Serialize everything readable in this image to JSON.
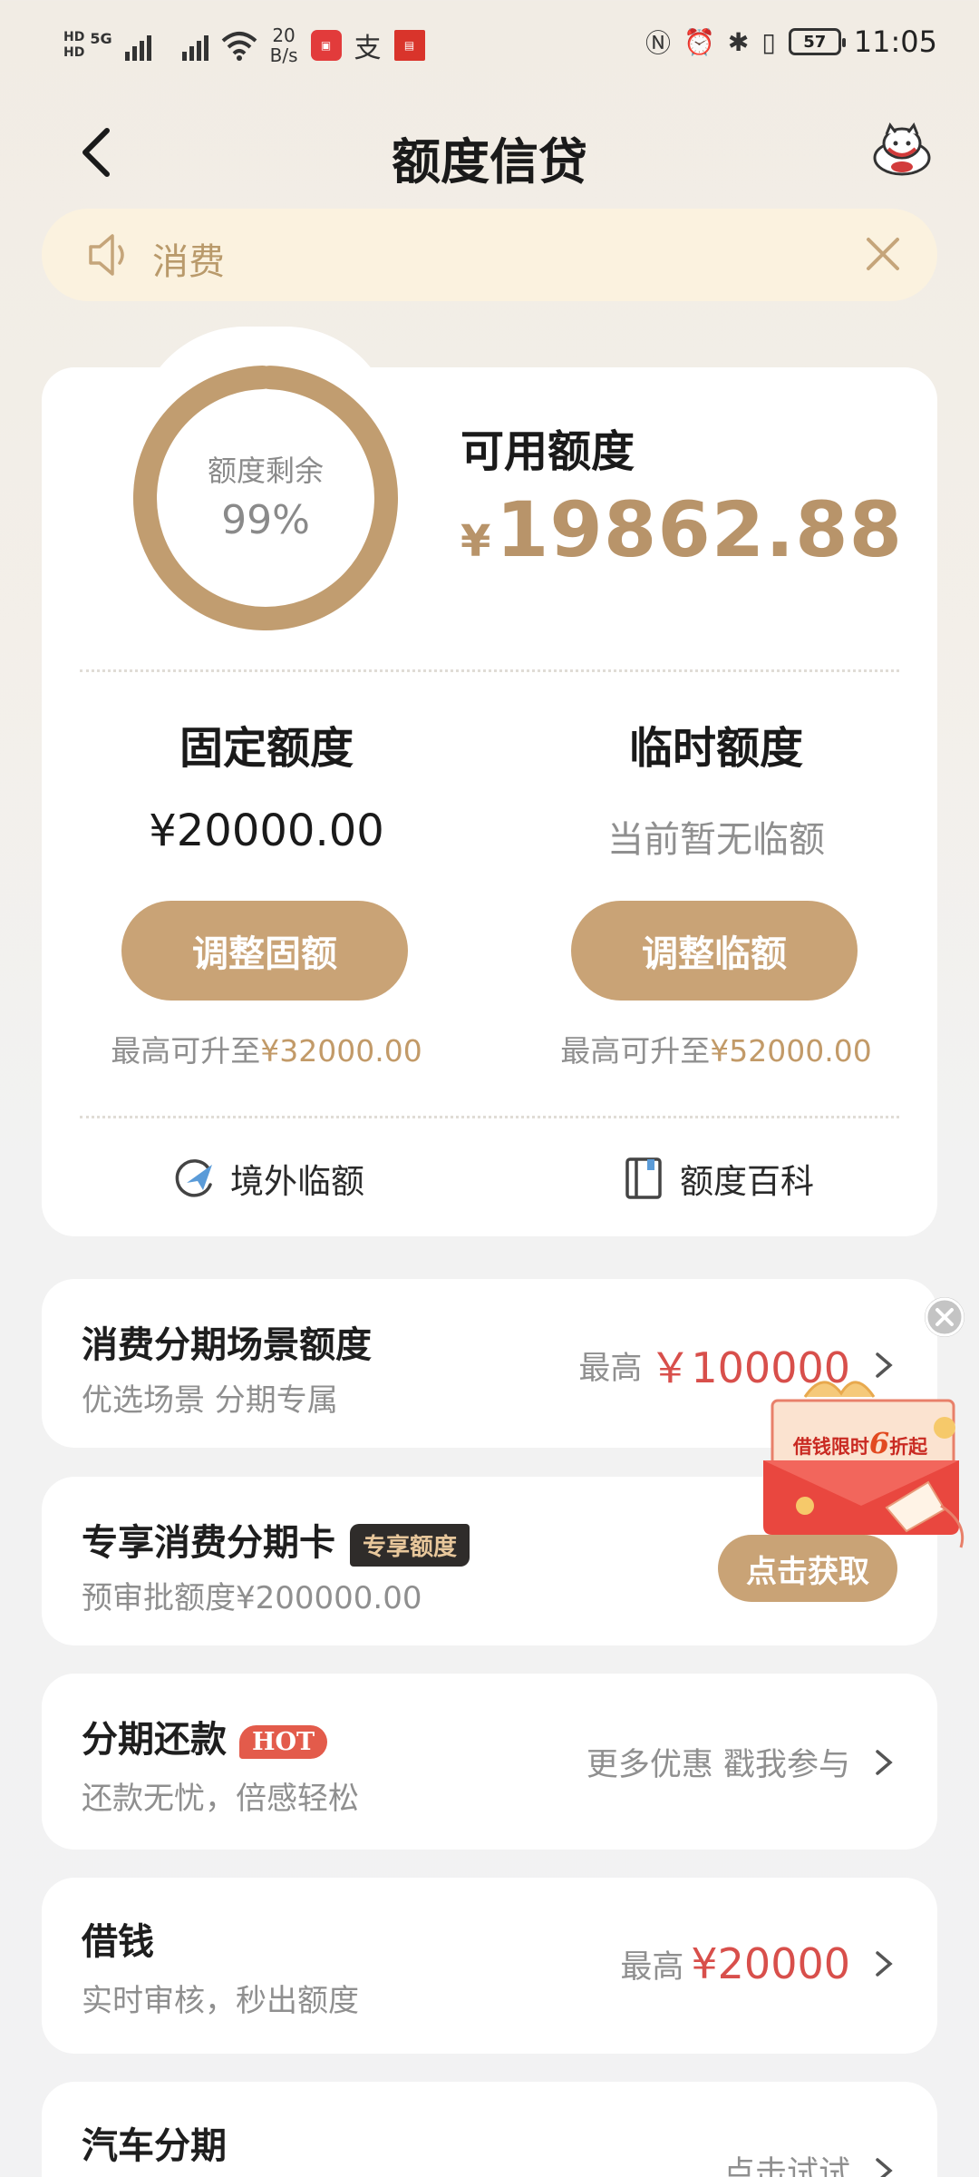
{
  "status_bar": {
    "network": "5G",
    "speed_value": "20",
    "speed_unit": "B/s",
    "battery": "57",
    "time": "11:05"
  },
  "header": {
    "title": "额度信贷"
  },
  "notice": {
    "text": "消费"
  },
  "credit": {
    "ring_label": "额度剩余",
    "ring_percent": "99%",
    "remaining_fraction": 0.99,
    "available_label": "可用额度",
    "currency": "¥",
    "available_amount": "19862.88",
    "fixed": {
      "title": "固定额度",
      "value": "¥20000.00",
      "button": "调整固额",
      "hint_prefix": "最高可升至",
      "hint_amount": "¥32000.00"
    },
    "temporary": {
      "title": "临时额度",
      "value": "当前暂无临额",
      "button": "调整临额",
      "hint_prefix": "最高可升至",
      "hint_amount": "¥52000.00"
    },
    "links": {
      "overseas": "境外临额",
      "wiki": "额度百科"
    }
  },
  "items": {
    "scene": {
      "title": "消费分期场景额度",
      "subtitle": "优选场景 分期专属",
      "right_prefix": "最高",
      "right_amount": "￥100000"
    },
    "card": {
      "title": "专享消费分期卡",
      "tag": "专享额度",
      "subtitle": "预审批额度¥200000.00",
      "button": "点击获取"
    },
    "installment": {
      "title": "分期还款",
      "tag": "HOT",
      "subtitle": "还款无忧，倍感轻松",
      "right_text": "更多优惠 戳我参与"
    },
    "loan": {
      "title": "借钱",
      "subtitle": "实时审核，秒出额度",
      "right_prefix": "最高",
      "right_amount": "¥20000"
    },
    "car": {
      "title": "汽车分期",
      "right_text": "点击试试"
    }
  },
  "promo": {
    "text_before": "借钱限时",
    "text_number": "6",
    "text_after": "折起"
  },
  "colors": {
    "gold": "#c9a376",
    "gold_text": "#b8946a",
    "red": "#d84f4b",
    "notice_bg": "#fbf2df"
  }
}
